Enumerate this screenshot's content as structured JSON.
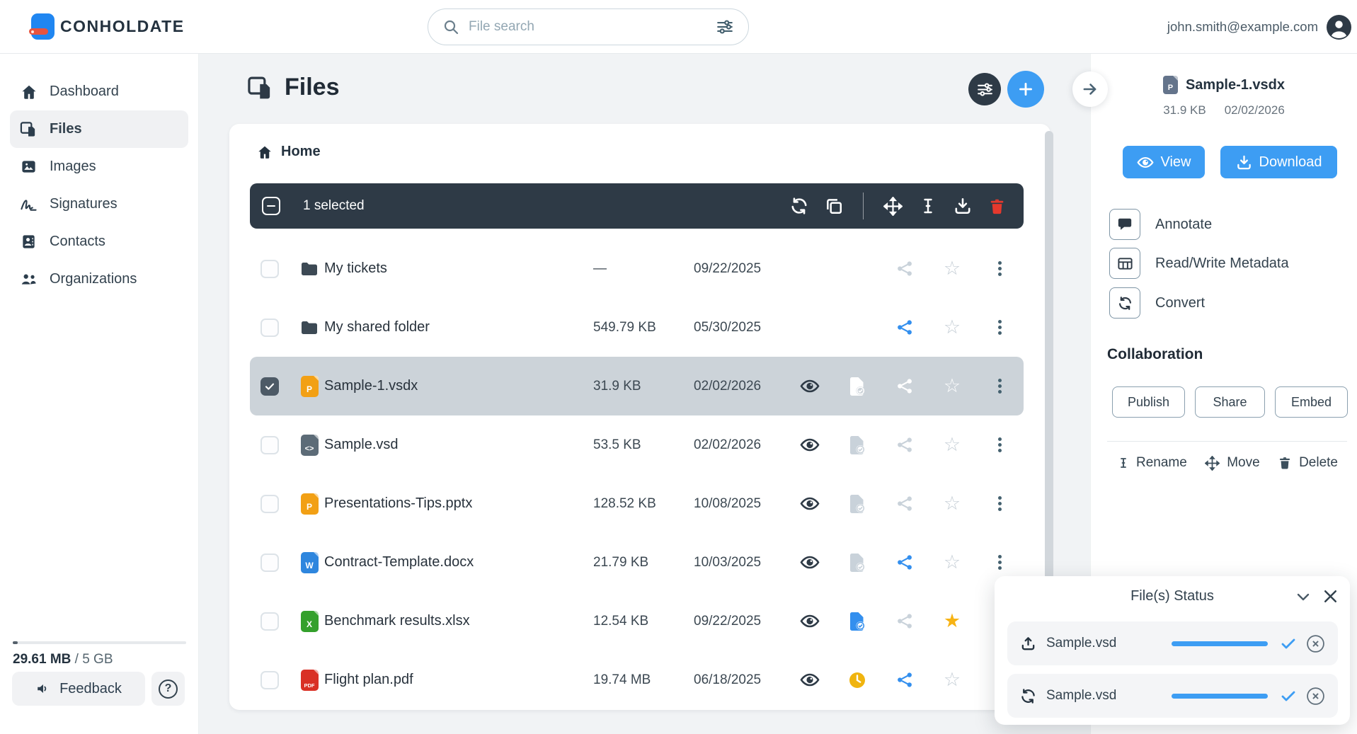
{
  "header": {
    "brand": "CONHOLDATE",
    "search": {
      "placeholder": "File search"
    },
    "user_email": "john.smith@example.com"
  },
  "sidebar": {
    "items": [
      {
        "label": "Dashboard"
      },
      {
        "label": "Files"
      },
      {
        "label": "Images"
      },
      {
        "label": "Signatures"
      },
      {
        "label": "Contacts"
      },
      {
        "label": "Organizations"
      }
    ],
    "storage": {
      "used": "29.61 MB",
      "total_text": "/ 5 GB"
    },
    "feedback_label": "Feedback",
    "help_label": "?"
  },
  "main": {
    "title": "Files",
    "breadcrumb": "Home",
    "selection": {
      "selected_text": "1 selected"
    },
    "rows": [
      {
        "name": "My tickets",
        "size": "—",
        "date": "09/22/2025",
        "type": "folder",
        "badge": ""
      },
      {
        "name": "My shared folder",
        "size": "549.79 KB",
        "date": "05/30/2025",
        "type": "folder",
        "badge": ""
      },
      {
        "name": "Sample-1.vsdx",
        "size": "31.9 KB",
        "date": "02/02/2026",
        "type": "vsdx",
        "badge": "P"
      },
      {
        "name": "Sample.vsd",
        "size": "53.5 KB",
        "date": "02/02/2026",
        "type": "vsd",
        "badge": "<>"
      },
      {
        "name": "Presentations-Tips.pptx",
        "size": "128.52 KB",
        "date": "10/08/2025",
        "type": "pptx",
        "badge": "P"
      },
      {
        "name": "Contract-Template.docx",
        "size": "21.79 KB",
        "date": "10/03/2025",
        "type": "docx",
        "badge": "W"
      },
      {
        "name": "Benchmark results.xlsx",
        "size": "12.54 KB",
        "date": "09/22/2025",
        "type": "xlsx",
        "badge": "X"
      },
      {
        "name": "Flight plan.pdf",
        "size": "19.74 MB",
        "date": "06/18/2025",
        "type": "pdf",
        "badge": "PDF"
      }
    ]
  },
  "details": {
    "file_name": "Sample-1.vsdx",
    "file_badge": "P",
    "file_size": "31.9 KB",
    "file_date": "02/02/2026",
    "view_label": "View",
    "download_label": "Download",
    "actions": [
      {
        "label": "Annotate"
      },
      {
        "label": "Read/Write Metadata"
      },
      {
        "label": "Convert"
      }
    ],
    "collaboration_title": "Collaboration",
    "publish_label": "Publish",
    "share_label": "Share",
    "embed_label": "Embed",
    "rename_label": "Rename",
    "move_label": "Move",
    "delete_label": "Delete"
  },
  "status": {
    "title": "File(s) Status",
    "items": [
      {
        "name": "Sample.vsd",
        "operation": "upload",
        "progress_pct": 100
      },
      {
        "name": "Sample.vsd",
        "operation": "convert",
        "progress_pct": 100
      }
    ]
  },
  "colors": {
    "accent_blue": "#3d9df3",
    "dark_navy": "#2e3a46",
    "selected_row": "#ccd3d9",
    "star_gold": "#f7b314",
    "trash_red": "#e5392d",
    "logo_blue": "#2086f1",
    "logo_red": "#e8543f"
  }
}
